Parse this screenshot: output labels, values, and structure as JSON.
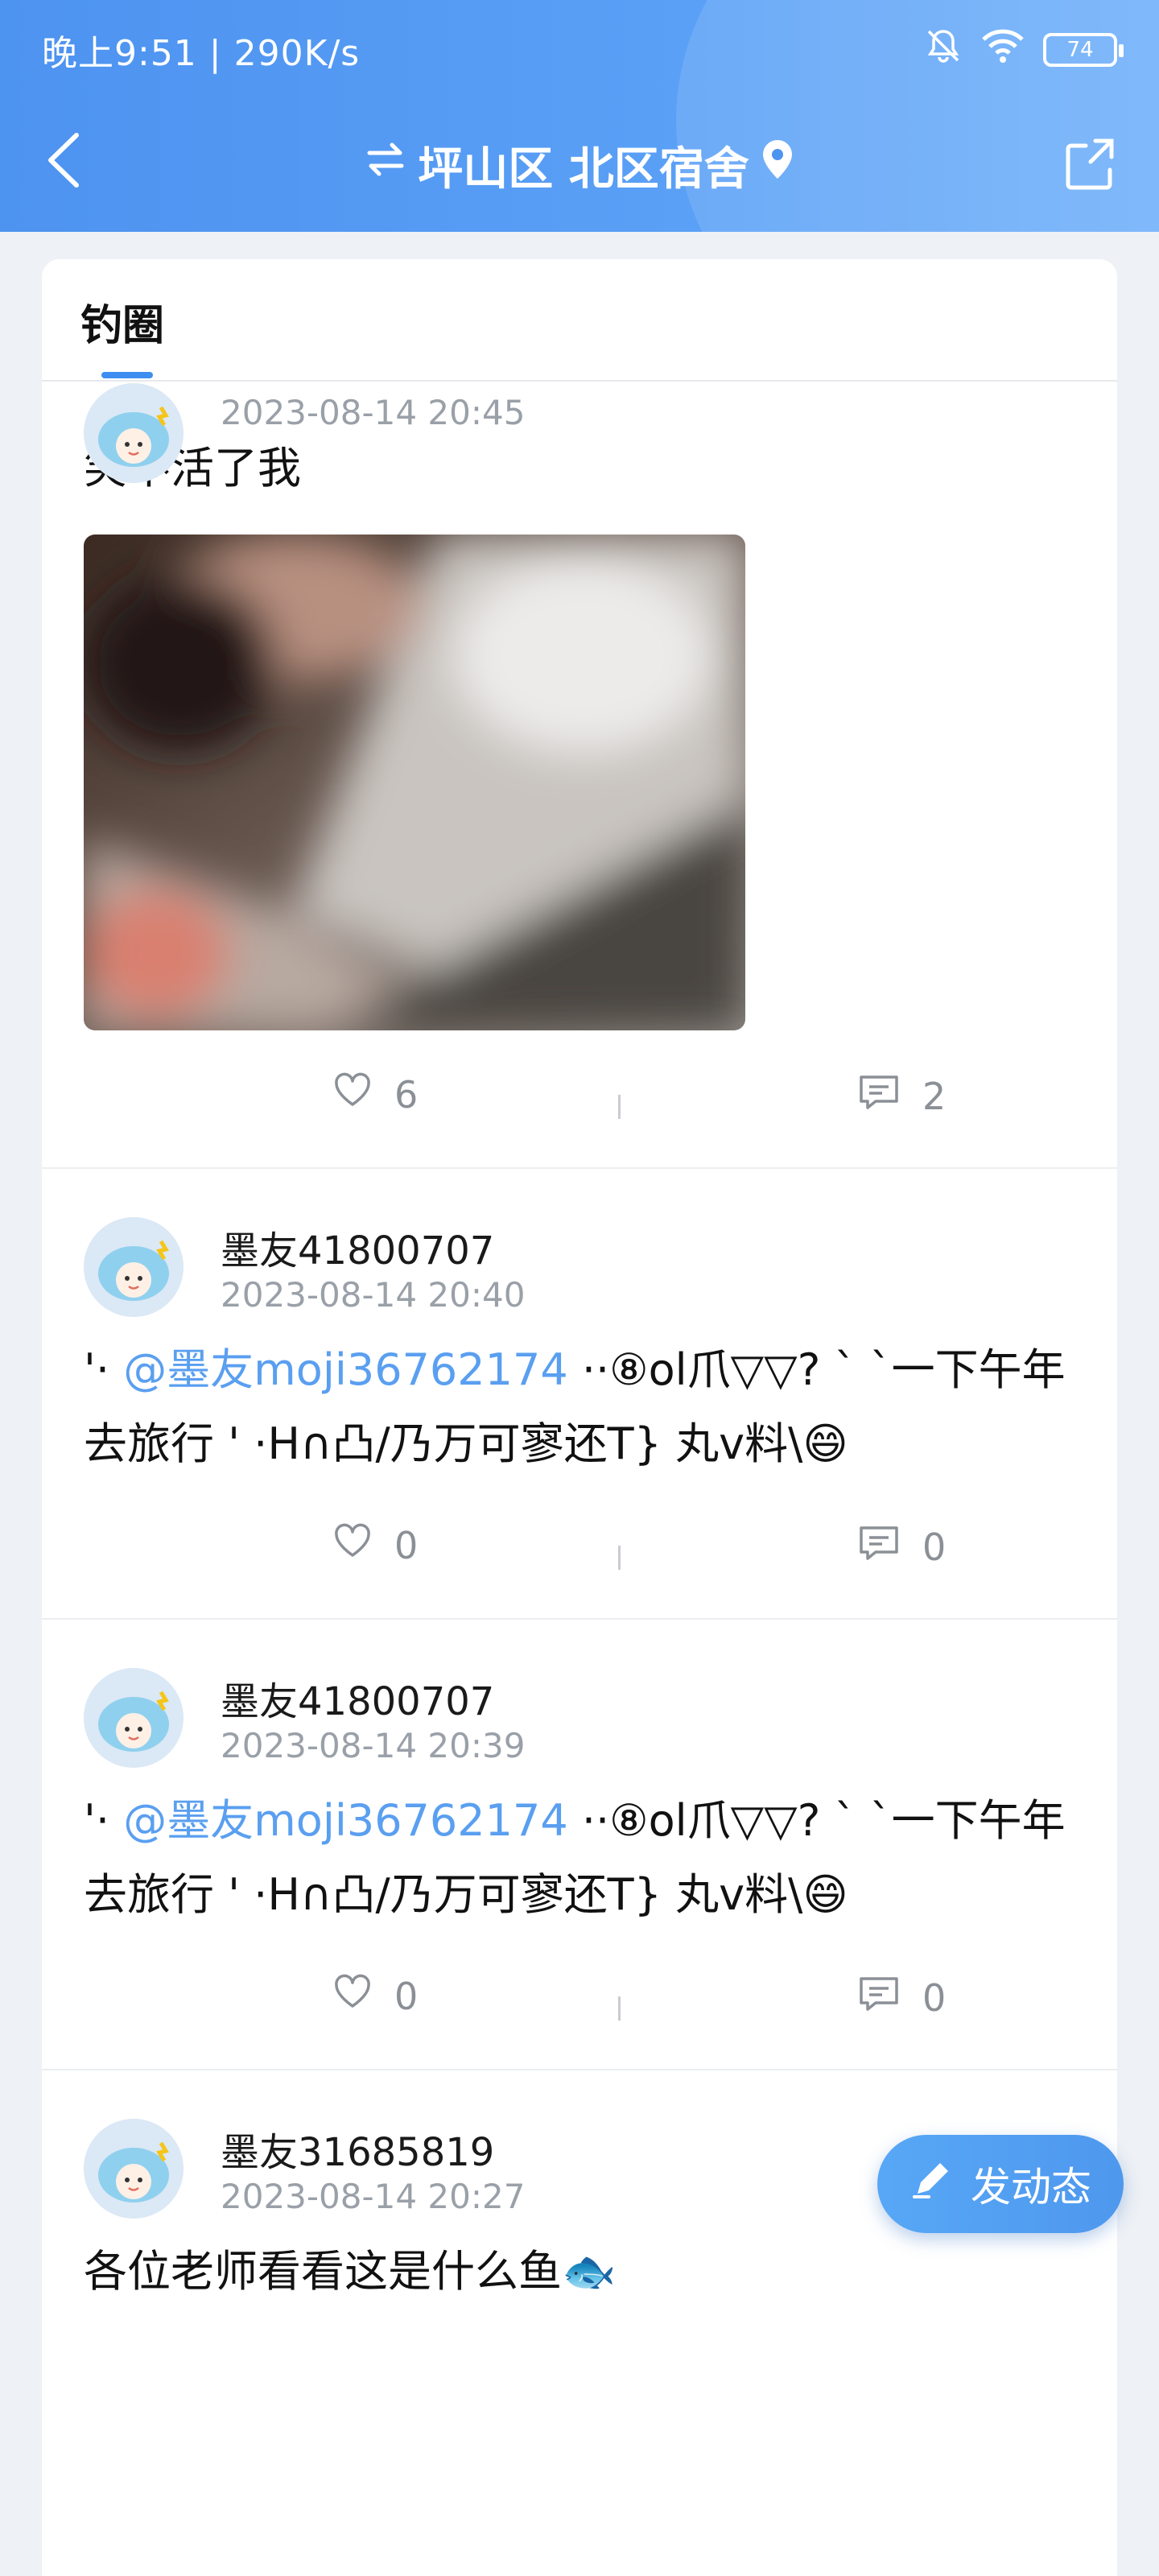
{
  "status_bar": {
    "time_speed": "晚上9:51 | 290K/s",
    "battery": "74"
  },
  "nav": {
    "title": "坪山区 北区宿舍"
  },
  "tabs": [
    {
      "label": "钓圈"
    }
  ],
  "posts": [
    {
      "time": "2023-08-14  20:45",
      "text": "笑不活了我",
      "likes": "6",
      "comments": "2"
    },
    {
      "username": "墨友41800707",
      "time": "2023-08-14  20:40",
      "prefix": "'· ",
      "mention": "@墨友moji36762174",
      "text": " ··⑧ol爪▽▽?  ` `一下午年去旅行 ' ·H∩凸/乃万可寥还T} 丸v料\\😄",
      "likes": "0",
      "comments": "0"
    },
    {
      "username": "墨友41800707",
      "time": "2023-08-14  20:39",
      "prefix": "'· ",
      "mention": "@墨友moji36762174",
      "text": " ··⑧ol爪▽▽?  ` `一下午年去旅行 ' ·H∩凸/乃万可寥还T} 丸v料\\😄",
      "likes": "0",
      "comments": "0"
    },
    {
      "username": "墨友31685819",
      "time": "2023-08-14  20:27",
      "text": "各位老师看看这是什么鱼🐟"
    }
  ],
  "fab": {
    "label": "发动态"
  },
  "icons": {
    "back": "chevron-left-icon",
    "swap": "swap-icon",
    "location": "location-pin-icon",
    "share": "share-icon",
    "like": "heart-icon",
    "comment": "comment-icon",
    "edit": "pencil-icon",
    "silent": "bell-off-icon",
    "wifi": "wifi-icon"
  }
}
